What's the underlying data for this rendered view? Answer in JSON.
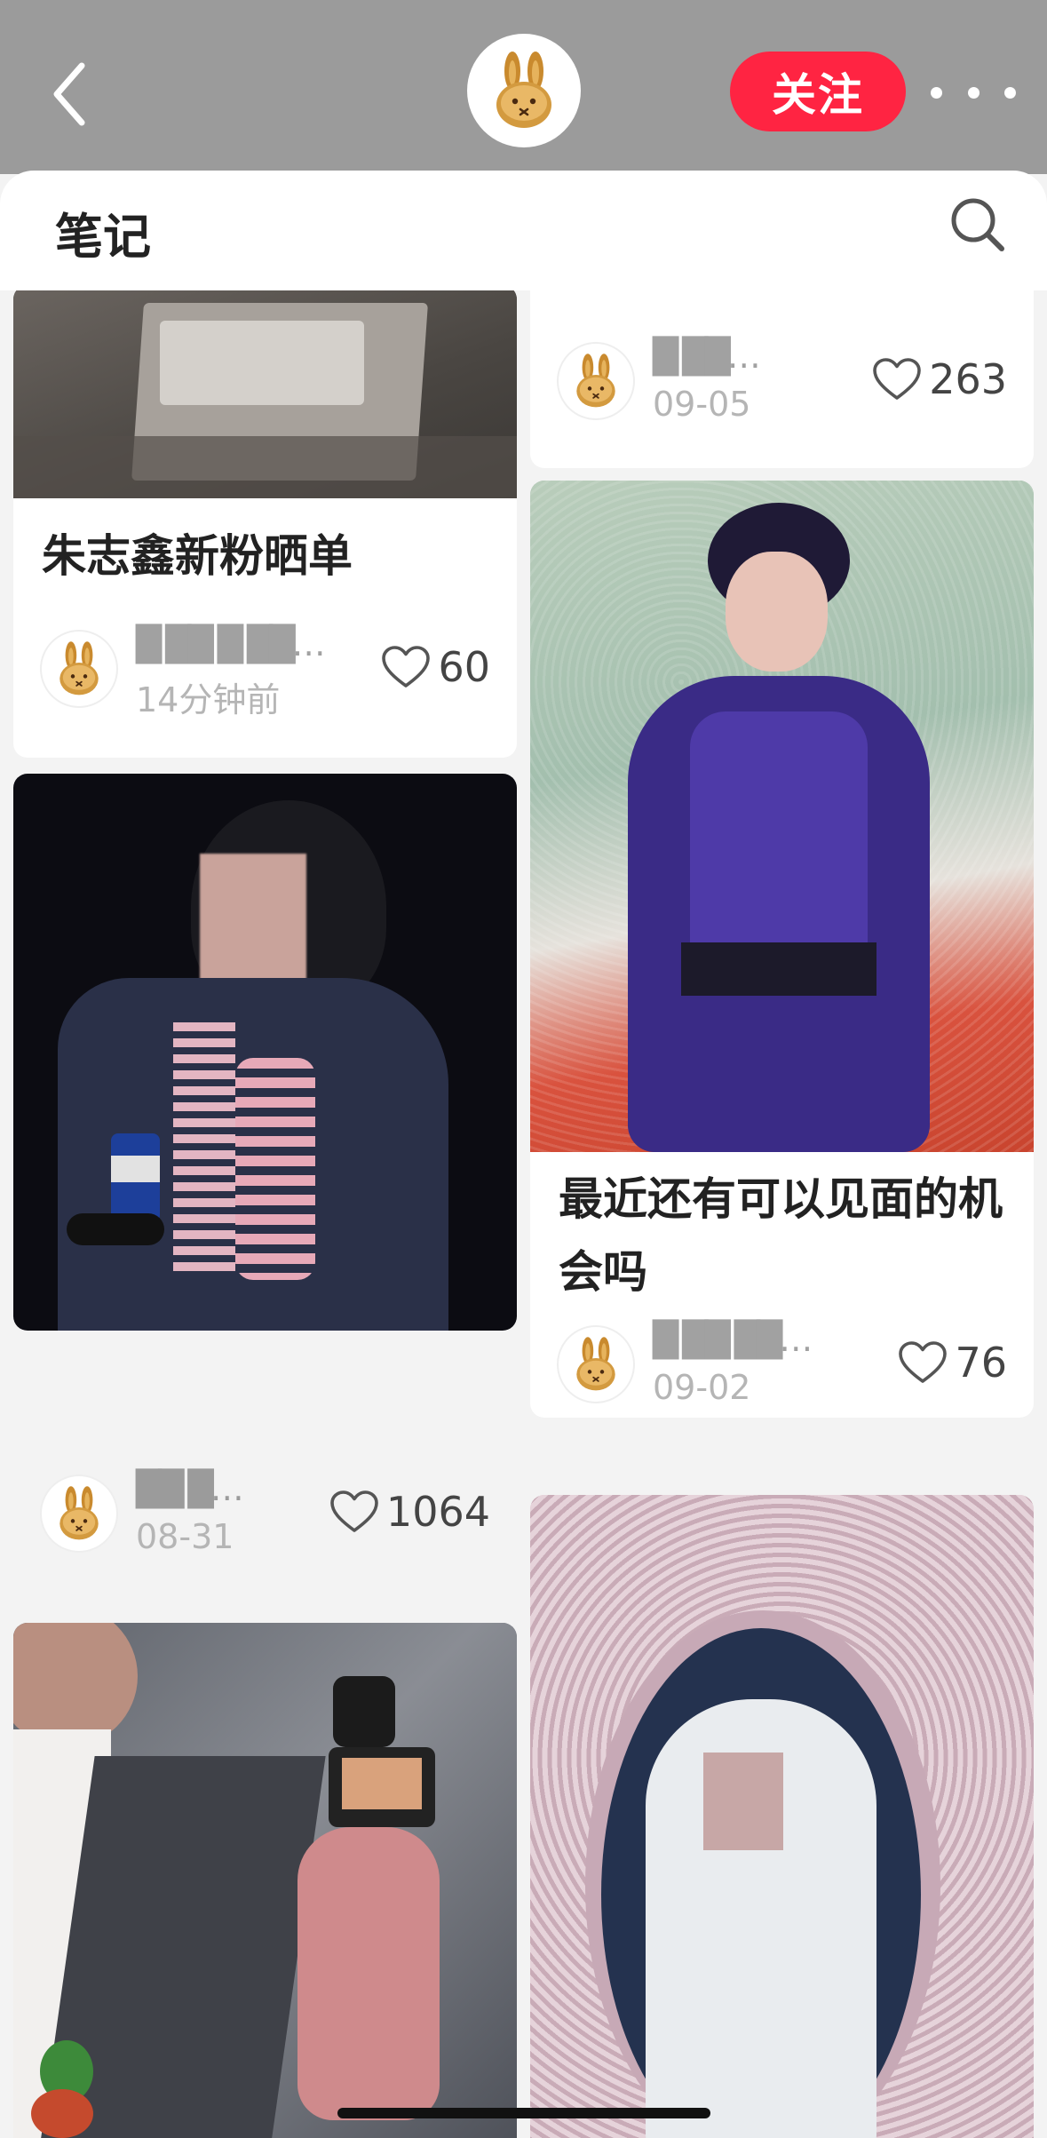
{
  "header": {
    "follow_label": "关注",
    "colors": {
      "accent": "#ff2442",
      "bar": "#9b9b9b"
    },
    "icons": [
      "back-arrow-icon",
      "rabbit-avatar-icon",
      "more-dots-icon",
      "search-icon",
      "heart-icon"
    ]
  },
  "sheet": {
    "title": "笔记"
  },
  "notes": [
    {
      "title": "朱志鑫新粉晒单",
      "author": "█ ██ █ ██…",
      "date": "14分钟前",
      "likes": "60"
    },
    {
      "title": "",
      "author": "██ █…",
      "date": "08-31",
      "likes": "1064"
    },
    {
      "title": "",
      "author": "",
      "date": "",
      "likes": ""
    },
    {
      "title": "",
      "author": "█ ██…",
      "date": "09-05",
      "likes": "263"
    },
    {
      "title": "最近还有可以见面的机会吗",
      "author": "█ ██ ██…",
      "date": "09-02",
      "likes": "76"
    },
    {
      "title": "",
      "author": "",
      "date": "",
      "likes": ""
    }
  ]
}
